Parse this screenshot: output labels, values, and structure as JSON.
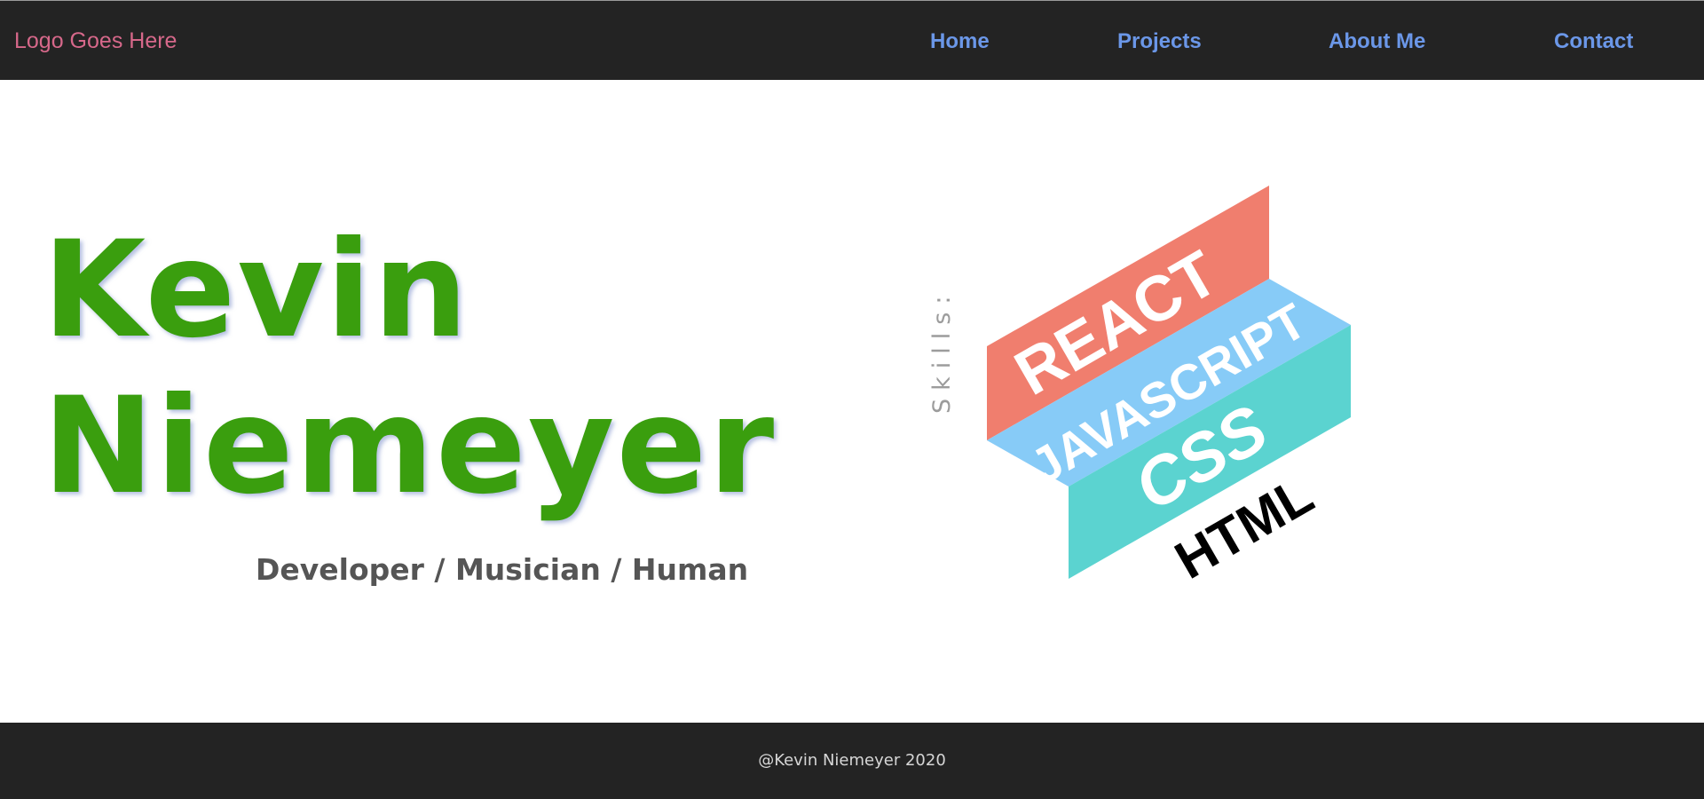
{
  "header": {
    "logo_text": "Logo Goes Here",
    "nav": [
      {
        "label": "Home"
      },
      {
        "label": "Projects"
      },
      {
        "label": "About Me"
      },
      {
        "label": "Contact"
      }
    ]
  },
  "hero": {
    "name_first": "Kevin",
    "name_last": "Niemeyer",
    "tagline": "Developer / Musician / Human"
  },
  "skills": {
    "label": "Skills:",
    "items": [
      "REACT",
      "JAVASCRIPT",
      "CSS",
      "HTML"
    ]
  },
  "footer": {
    "text": "@Kevin Niemeyer 2020"
  },
  "colors": {
    "header_bg": "#232323",
    "logo": "#d6688a",
    "nav_link": "#6b97e8",
    "name": "#3a9e0e",
    "tagline": "#555555",
    "react_face": "#f07e6e",
    "javascript_face": "#87cbf7",
    "css_face": "#5bd3d0",
    "html_text": "#000000"
  }
}
